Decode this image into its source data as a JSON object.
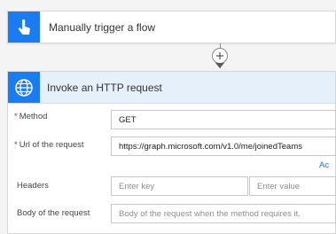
{
  "trigger": {
    "title": "Manually trigger a flow",
    "icon": "touch-icon"
  },
  "action": {
    "title": "Invoke an HTTP request",
    "icon": "globe-icon",
    "fields": {
      "method": {
        "label": "Method",
        "value": "GET"
      },
      "url": {
        "label": "Url of the request",
        "value": "https://graph.microsoft.com/v1.0/me/joinedTeams"
      },
      "headers": {
        "label": "Headers",
        "key_placeholder": "Enter key",
        "value_placeholder": "Enter value"
      },
      "body": {
        "label": "Body of the request",
        "placeholder": "Body of the request when the method requires it."
      }
    },
    "add_link": "Ac"
  },
  "colors": {
    "accent": "#1a7cf0",
    "header_bg": "#e6f0fa",
    "required": "#c4262e",
    "link": "#2471c8"
  }
}
